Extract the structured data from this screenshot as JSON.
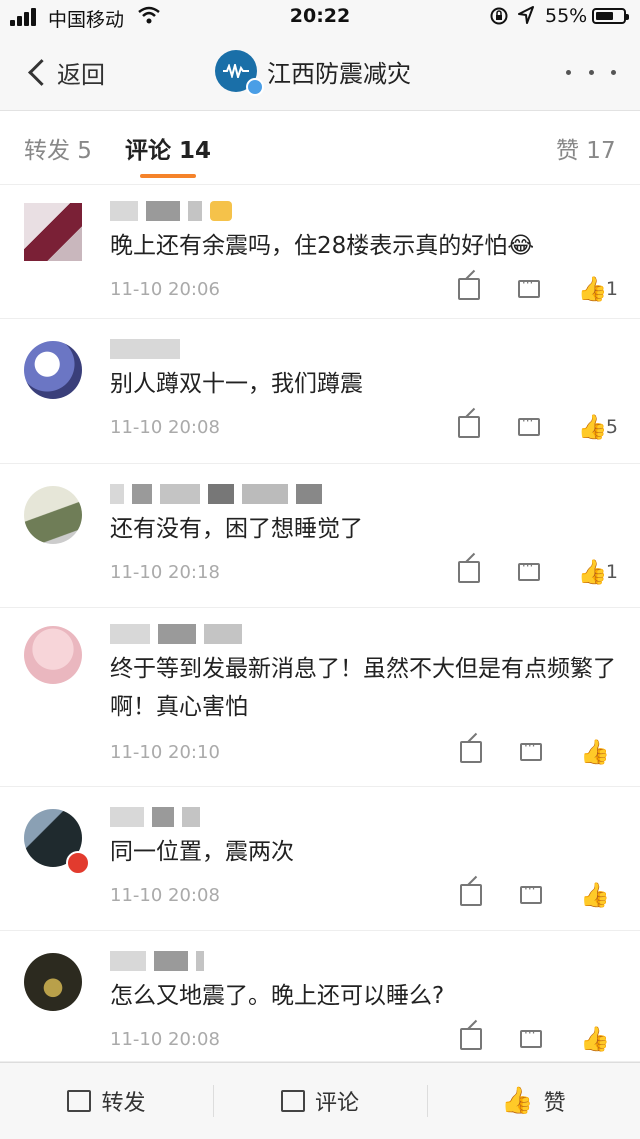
{
  "status": {
    "carrier": "中国移动",
    "time": "20:22",
    "battery": "55%"
  },
  "nav": {
    "back_label": "返回",
    "title": "江西防震减灾"
  },
  "tabs": [
    {
      "label": "转发 5"
    },
    {
      "label": "评论 14"
    },
    {
      "label": "赞 17"
    }
  ],
  "comments": [
    {
      "text": "晚上还有余震吗，住28楼表示真的好怕😂",
      "time": "11-10 20:06",
      "likes": "1"
    },
    {
      "text": "别人蹲双十一，我们蹲震",
      "time": "11-10 20:08",
      "likes": "5"
    },
    {
      "text": "还有没有，困了想睡觉了",
      "time": "11-10 20:18",
      "likes": "1"
    },
    {
      "text": "终于等到发最新消息了！虽然不大但是有点频繁了啊！真心害怕",
      "time": "11-10 20:10",
      "likes": ""
    },
    {
      "text": "同一位置，震两次",
      "time": "11-10 20:08",
      "likes": ""
    },
    {
      "text": "怎么又地震了。晚上还可以睡么?",
      "time": "11-10 20:08",
      "likes": ""
    }
  ],
  "bottom": {
    "repost": "转发",
    "comment": "评论",
    "like": "赞"
  },
  "colors": {
    "accent": "#f5832a",
    "bar_bg": "#f7f7f7"
  }
}
